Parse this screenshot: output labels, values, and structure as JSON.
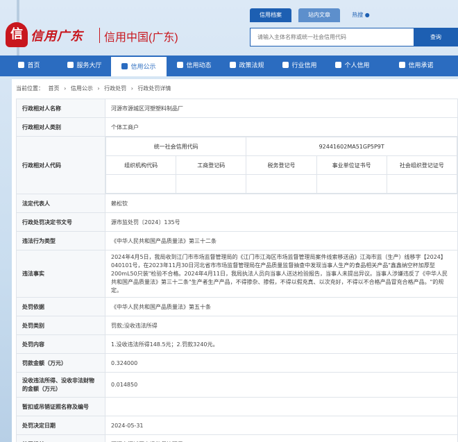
{
  "header": {
    "logo_badge": "信",
    "logo_script": "信用广东",
    "site_title": "信用中国(广东)",
    "tabs": [
      "信用档案",
      "站内文章",
      "热搜"
    ],
    "search_placeholder": "请输入主体名称或统一社会信用代码",
    "search_button": "查询"
  },
  "nav": [
    {
      "label": "首页",
      "icon": "home-icon"
    },
    {
      "label": "服务大厅",
      "icon": "grid-icon"
    },
    {
      "label": "信用公示",
      "icon": "notice-icon",
      "active": true
    },
    {
      "label": "信用动态",
      "icon": "news-icon"
    },
    {
      "label": "政策法规",
      "icon": "book-icon"
    },
    {
      "label": "行业信用",
      "icon": "industry-icon"
    },
    {
      "label": "个人信用",
      "icon": "person-icon"
    },
    {
      "label": "信用承诺",
      "icon": "promise-icon"
    }
  ],
  "breadcrumb": [
    "当前位置：",
    "首页",
    "›",
    "信用公示",
    "›",
    "行政处罚",
    "›",
    "行政处罚详情"
  ],
  "detail": {
    "name_label": "行政相对人名称",
    "name": "河源市源城区河塑塑料制品厂",
    "category_label": "行政相对人类别",
    "category": "个体工商户",
    "code_label": "行政相对人代码",
    "usci_label": "统一社会信用代码",
    "usci": "92441602MA51GP5P9T",
    "code_headers": [
      "组织机构代码",
      "工商登记码",
      "税务登记号",
      "事业单位证书号",
      "社会组织登记证号"
    ],
    "rep_label": "法定代表人",
    "rep": "赖松钦",
    "doc_label": "行政处罚决定书文号",
    "doc": "源市监处罚〔2024〕135号",
    "type_label": "违法行为类型",
    "type": "《中华人民共和国产品质量法》第三十二条",
    "fact_label": "违法事实",
    "fact": "2024年4月5日，我局收到江门市市场监督管理局的《江门市江海区市场监督管理局案件线索移送函》江海市监（生产）线移字【2024】040101号，在2023年11月30日河北省市市场监督管理局在产品质量监督抽查中发现当事人生产的食品相关产品\"鑫鑫纳空杯加厚型200mL50只装\"检验不合格。2024年4月11日，我局执法人员向当事人送达检验报告，当事人未提出异议。当事人涉嫌违反了《中华人民共和国产品质量法》第三十二条\"生产者生产产品，不得掺杂、掺假，不得以假充真、以次充好，不得以不合格产品冒充合格产品。\"的规定。",
    "basis_label": "处罚依据",
    "basis": "《中华人民共和国产品质量法》第五十条",
    "ptype_label": "处罚类别",
    "ptype": "罚款;没收违法所得",
    "content_label": "处罚内容",
    "content": "1.没收违法所得148.5元；2.罚款3240元。",
    "fine_label": "罚款金额（万元）",
    "fine": "0.324000",
    "confiscate_label": "没收违法所得、没收非法财物的金额（万元）",
    "confiscate": "0.014850",
    "suspend_label": "暂扣或吊销证照名称及编号",
    "suspend": "",
    "date_label": "处罚决定日期",
    "date": "2024-05-31",
    "org_label": "处罚机关",
    "org": "河源市源城区市场监督管理局"
  }
}
